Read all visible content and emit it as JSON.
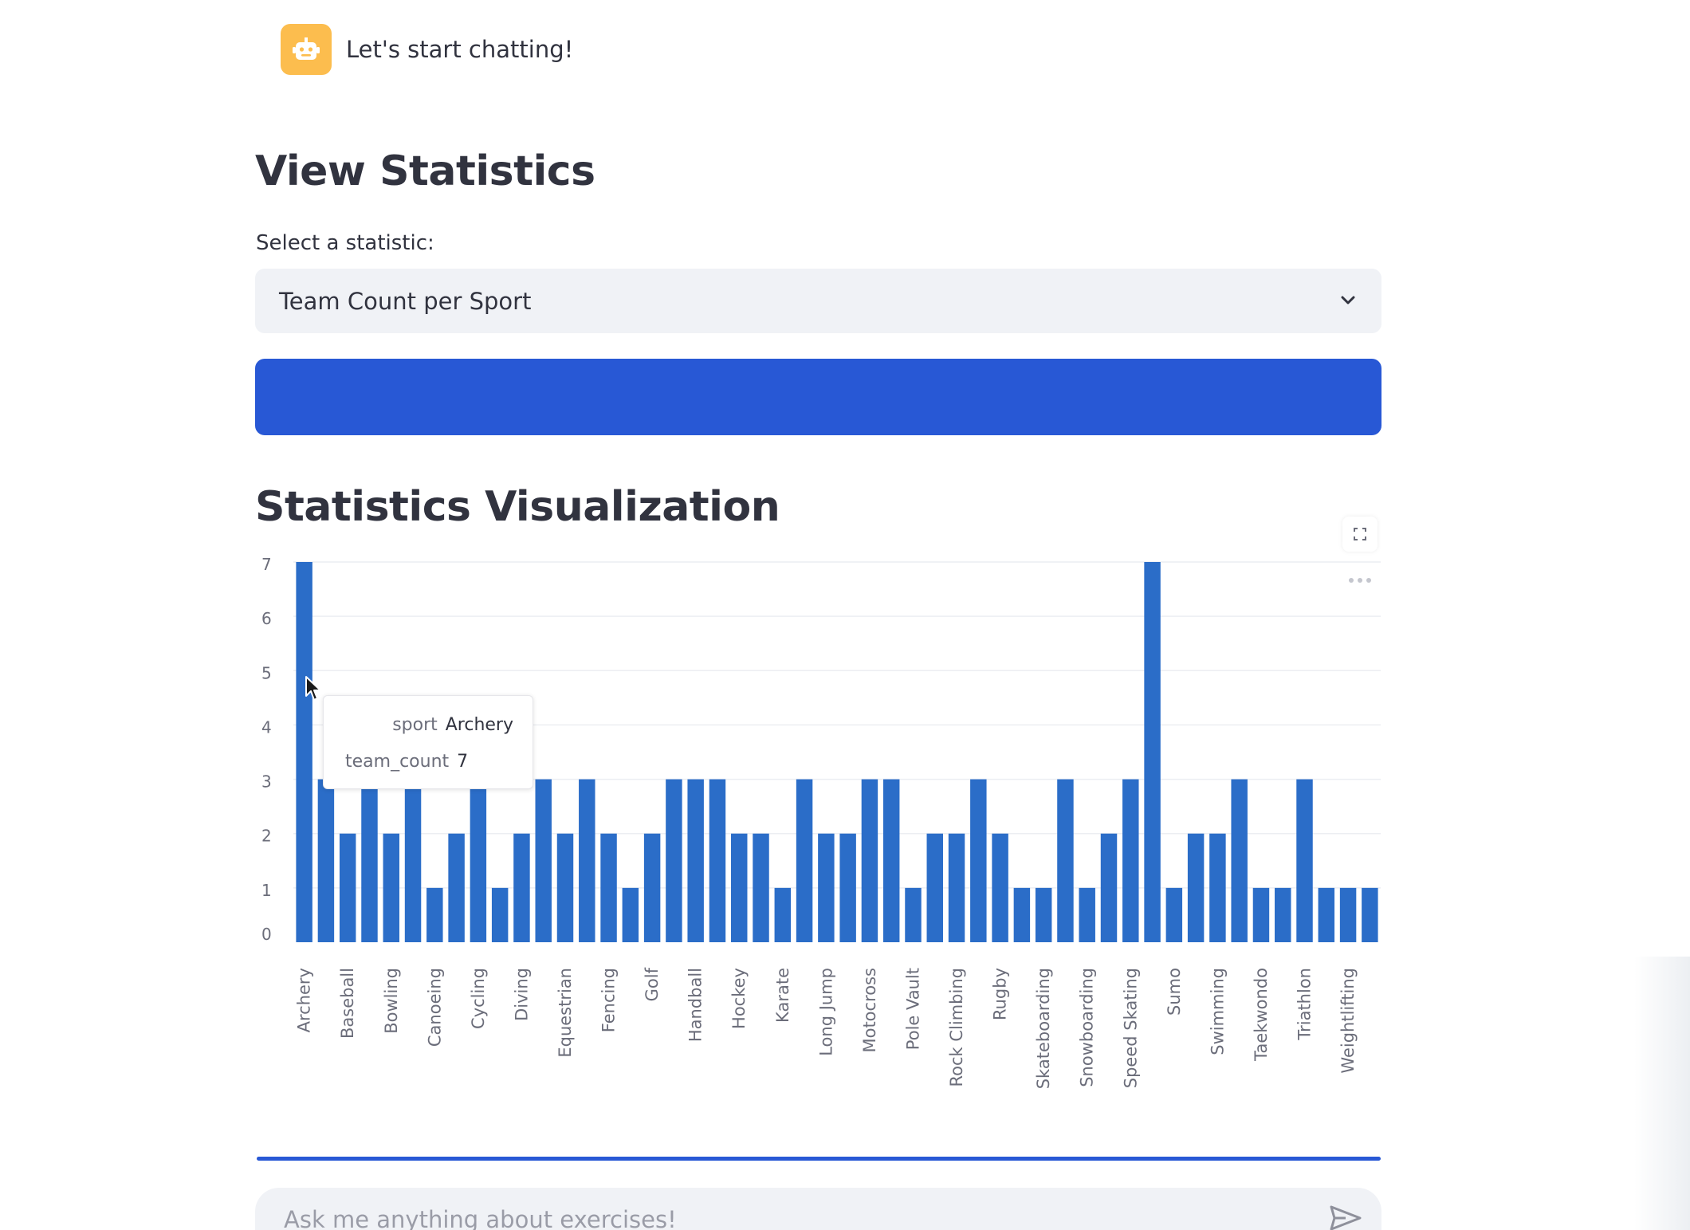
{
  "chat": {
    "message": "Let's start chatting!",
    "avatar_icon": "robot-icon",
    "avatar_color": "#fcbd4e"
  },
  "stats": {
    "title": "View Statistics",
    "select_label": "Select a statistic:",
    "select_value": "Team Count per Sport",
    "button_color": "#2858d5"
  },
  "visualization": {
    "title": "Statistics Visualization",
    "toolbar_icons": [
      "fullscreen-icon",
      "more-icon"
    ]
  },
  "tooltip": {
    "row1_key": "sport",
    "row1_value": "Archery",
    "row2_key": "team_count",
    "row2_value": "7"
  },
  "chat_input": {
    "placeholder": "Ask me anything about exercises!",
    "send_icon": "send-icon"
  },
  "chart_data": {
    "type": "bar",
    "xlabel": "",
    "ylabel": "",
    "ylim": [
      0,
      7
    ],
    "yticks": [
      0,
      1,
      2,
      3,
      4,
      5,
      6,
      7
    ],
    "grid": true,
    "bar_color": "#2b6dc8",
    "categories": [
      "Archery",
      "",
      "Baseball",
      "",
      "Bowling",
      "",
      "Canoeing",
      "",
      "Cycling",
      "",
      "Diving",
      "",
      "Equestrian",
      "",
      "Fencing",
      "",
      "Golf",
      "",
      "Handball",
      "",
      "Hockey",
      "",
      "Karate",
      "",
      "Long Jump",
      "",
      "Motocross",
      "",
      "Pole Vault",
      "",
      "Rock Climbing",
      "",
      "Rugby",
      "",
      "Skateboarding",
      "",
      "Snowboarding",
      "",
      "Speed Skating",
      "",
      "Sumo",
      "",
      "Swimming",
      "",
      "Taekwondo",
      "",
      "Triathlon",
      "",
      "Weightlifting",
      ""
    ],
    "values": [
      7,
      3,
      2,
      3,
      2,
      3,
      1,
      2,
      3,
      1,
      2,
      3,
      2,
      3,
      2,
      1,
      2,
      3,
      3,
      3,
      2,
      2,
      1,
      3,
      2,
      2,
      3,
      3,
      1,
      2,
      2,
      3,
      2,
      1,
      1,
      3,
      1,
      2,
      3,
      7,
      1,
      2,
      2,
      3,
      1,
      1,
      3,
      1,
      1,
      1
    ]
  }
}
